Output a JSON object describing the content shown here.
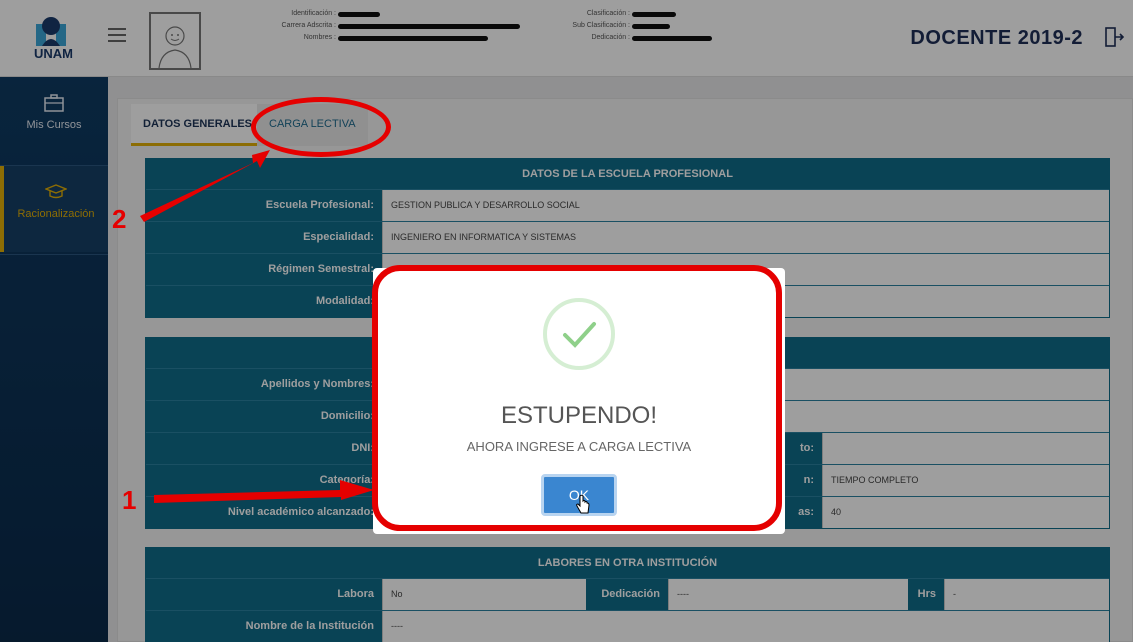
{
  "header": {
    "logo_text": "UNAM",
    "fields": [
      {
        "label": "Identificación :"
      },
      {
        "label": "Carrera Adscrita :"
      },
      {
        "label": "Nombres :"
      },
      {
        "label": "Clasificación :"
      },
      {
        "label": "Sub Clasificación :"
      },
      {
        "label": "Dedicación :"
      }
    ],
    "title": "DOCENTE 2019-2"
  },
  "sidebar": {
    "items": [
      {
        "label": "Mis Cursos",
        "icon": "briefcase-icon"
      },
      {
        "label": "Racionalización",
        "icon": "graduation-cap-icon"
      }
    ]
  },
  "tabs": [
    {
      "label": "DATOS GENERALES"
    },
    {
      "label": "CARGA LECTIVA"
    }
  ],
  "escuela": {
    "title": "DATOS DE LA ESCUELA PROFESIONAL",
    "rows": [
      {
        "label": "Escuela Profesional:",
        "value": "GESTION PUBLICA Y DESARROLLO SOCIAL"
      },
      {
        "label": "Especialidad:",
        "value": "INGENIERO EN INFORMATICA Y SISTEMAS"
      },
      {
        "label": "Régimen Semestral:",
        "value": ""
      },
      {
        "label": "Modalidad:",
        "value": ""
      }
    ]
  },
  "personal": {
    "rows": [
      {
        "label": "Apellidos y Nombres:",
        "value": ""
      },
      {
        "label": "Domicilio:",
        "value": ""
      },
      {
        "label": "DNI:",
        "value": "",
        "label2": "to:",
        "value2": ""
      },
      {
        "label": "Categoría:",
        "value": "",
        "label2": "n:",
        "value2": "TIEMPO COMPLETO"
      },
      {
        "label": "Nivel académico alcanzado:",
        "value": "",
        "label2": "as:",
        "value2": "40"
      }
    ]
  },
  "labores": {
    "title": "LABORES EN OTRA INSTITUCIÓN",
    "labora_label": "Labora",
    "labora_value": "No",
    "dedicacion_label": "Dedicación",
    "dedicacion_value": "----",
    "hrs_label": "Hrs",
    "hrs_value": "-",
    "institucion_label": "Nombre de la Institución",
    "institucion_value": "----"
  },
  "modal": {
    "title": "ESTUPENDO!",
    "message": "AHORA INGRESE A CARGA LECTIVA",
    "ok_label": "OK"
  },
  "annotations": {
    "step1": "1",
    "step2": "2"
  },
  "colors": {
    "accent": "#0f6c8a",
    "sidebar": "#0f3b63",
    "highlight": "#e50000",
    "button": "#3a86d0"
  }
}
